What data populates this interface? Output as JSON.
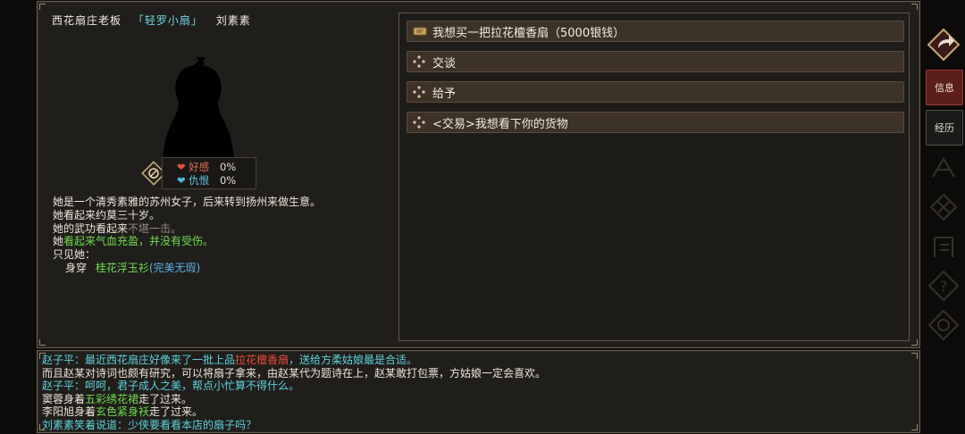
{
  "npc": {
    "title": "西花扇庄老板",
    "nickname": "「轻罗小扇」",
    "name": "刘素素"
  },
  "relation": {
    "affinity_label": "好感",
    "affinity_value": "0%",
    "hatred_label": "仇恨",
    "hatred_value": "0%"
  },
  "description": {
    "line1": "她是一个清秀素雅的苏州女子，后来转到扬州来做生意。",
    "line2": "她看起来约莫三十岁。",
    "line3_prefix": "她的武功看起来",
    "line3_value": "不堪一击。",
    "line4_prefix": "她",
    "line4_value": "看起来气血充盈，并没有受伤。",
    "line5": "只见她：",
    "wear_label": "身穿",
    "wear_item": "桂花浮玉衫",
    "wear_quality": "(完美无瑕)"
  },
  "options": [
    {
      "label": "我想买一把拉花檀香扇（5000银钱）",
      "icon": "scroll-icon"
    },
    {
      "label": "交谈",
      "icon": "diamond-icon"
    },
    {
      "label": "给予",
      "icon": "diamond-icon"
    },
    {
      "label": "<交易>我想看下你的货物",
      "icon": "diamond-icon"
    }
  ],
  "sidebar": {
    "info_label": "信息",
    "exp_label": "经历"
  },
  "log": {
    "l1_speaker": "赵子平：",
    "l1_a": "最近西花扇庄好像来了一批上品",
    "l1_item": "拉花檀香扇",
    "l1_b": "，送给方柔姑娘最是合适。",
    "l2": "而且赵某对诗词也颇有研究，可以将扇子拿来，由赵某代为题诗在上，赵某敢打包票，方姑娘一定会喜欢。",
    "l3": "赵子平：呵呵，君子成人之美，帮点小忙算不得什么。",
    "l4_a": "窦蓉身着",
    "l4_item": "五彩绣花裙",
    "l4_b": "走了过来。",
    "l5_a": "李阳旭身着",
    "l5_item": "玄色紧身袄",
    "l5_b": "走了过来。",
    "l6": "刘素素笑着说道：少侠要看看本店的扇子吗？"
  },
  "colors": {
    "panel_bg": "#201e1b",
    "option_bg": "#3d3228",
    "accent_red": "#5b1e1a",
    "green_text": "#6fdc4e",
    "cyan_text": "#5ed2e0",
    "red_text": "#ef4a3a"
  }
}
